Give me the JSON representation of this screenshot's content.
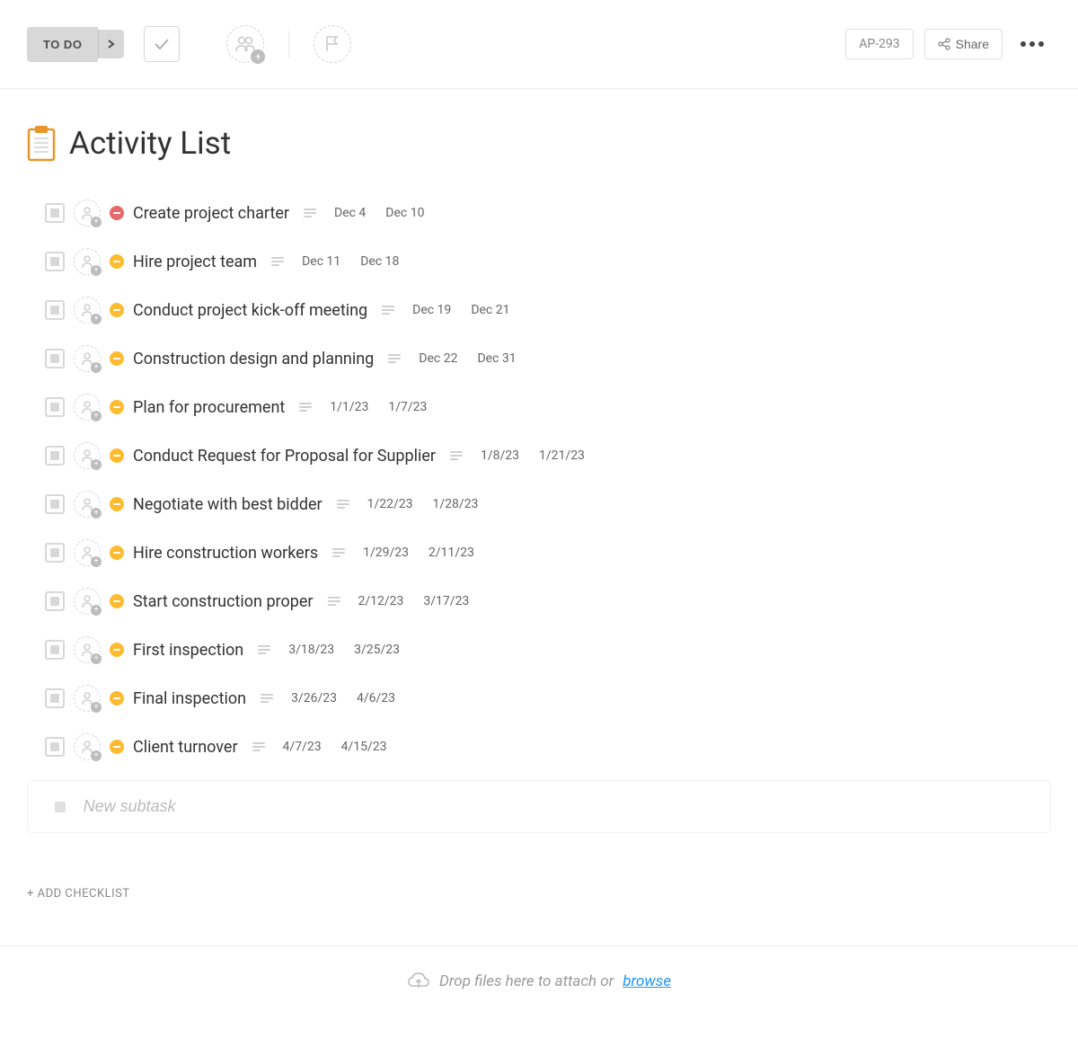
{
  "toolbar": {
    "status_label": "TO DO",
    "ap_id": "AP-293",
    "share_label": "Share"
  },
  "page": {
    "title": "Activity List"
  },
  "tasks": [
    {
      "title": "Create project charter",
      "start": "Dec 4",
      "end": "Dec 10",
      "priority": "red"
    },
    {
      "title": "Hire project team",
      "start": "Dec 11",
      "end": "Dec 18",
      "priority": "yellow"
    },
    {
      "title": "Conduct project kick-off meeting",
      "start": "Dec 19",
      "end": "Dec 21",
      "priority": "yellow"
    },
    {
      "title": "Construction design and planning",
      "start": "Dec 22",
      "end": "Dec 31",
      "priority": "yellow"
    },
    {
      "title": "Plan for procurement",
      "start": "1/1/23",
      "end": "1/7/23",
      "priority": "yellow"
    },
    {
      "title": "Conduct Request for Proposal for Supplier",
      "start": "1/8/23",
      "end": "1/21/23",
      "priority": "yellow"
    },
    {
      "title": "Negotiate with best bidder",
      "start": "1/22/23",
      "end": "1/28/23",
      "priority": "yellow"
    },
    {
      "title": "Hire construction workers",
      "start": "1/29/23",
      "end": "2/11/23",
      "priority": "yellow"
    },
    {
      "title": "Start construction proper",
      "start": "2/12/23",
      "end": "3/17/23",
      "priority": "yellow"
    },
    {
      "title": "First inspection",
      "start": "3/18/23",
      "end": "3/25/23",
      "priority": "yellow"
    },
    {
      "title": "Final inspection",
      "start": "3/26/23",
      "end": "4/6/23",
      "priority": "yellow"
    },
    {
      "title": "Client turnover",
      "start": "4/7/23",
      "end": "4/15/23",
      "priority": "yellow"
    }
  ],
  "new_subtask": {
    "placeholder": "New subtask"
  },
  "add_checklist_label": "+ ADD CHECKLIST",
  "drop_area": {
    "text": "Drop files here to attach or ",
    "link": "browse"
  }
}
